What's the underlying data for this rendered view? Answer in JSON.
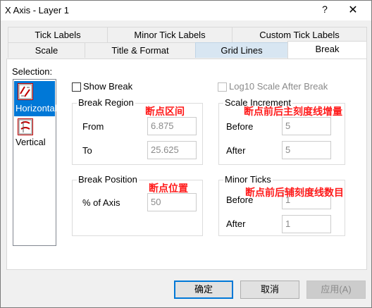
{
  "window": {
    "title": "X Axis - Layer 1",
    "help_label": "?",
    "close_label": "✕"
  },
  "tabs": {
    "row1": [
      {
        "label": "Tick Labels"
      },
      {
        "label": "Minor Tick Labels"
      },
      {
        "label": "Custom Tick Labels"
      }
    ],
    "row2": [
      {
        "label": "Scale"
      },
      {
        "label": "Title & Format"
      },
      {
        "label": "Grid Lines"
      },
      {
        "label": "Break"
      }
    ],
    "selected": "Break"
  },
  "selection": {
    "label": "Selection:",
    "items": [
      {
        "label": "Horizontal",
        "icon": "horizontal-break-icon",
        "selected": true
      },
      {
        "label": "Vertical",
        "icon": "vertical-break-icon",
        "selected": false
      }
    ]
  },
  "show_break": {
    "label": "Show Break",
    "checked": false
  },
  "log10": {
    "label": "Log10 Scale After Break",
    "checked": false,
    "disabled": true
  },
  "break_region": {
    "title": "Break Region",
    "from_label": "From",
    "from_value": "6.875",
    "to_label": "To",
    "to_value": "25.625"
  },
  "scale_increment": {
    "title": "Scale Increment",
    "before_label": "Before",
    "before_value": "5",
    "after_label": "After",
    "after_value": "5"
  },
  "break_position": {
    "title": "Break Position",
    "axis_label": "% of Axis",
    "axis_value": "50"
  },
  "minor_ticks": {
    "title": "Minor Ticks",
    "before_label": "Before",
    "before_value": "1",
    "after_label": "After",
    "after_value": "1"
  },
  "annotations": {
    "break_region": "断点区间",
    "scale_increment": "断点前后主刻度线增量",
    "break_position": "断点位置",
    "minor_ticks": "断点前后辅刻度线数目"
  },
  "buttons": {
    "ok": "确定",
    "cancel": "取消",
    "apply": "应用(A)"
  },
  "colors": {
    "annotation": "#ff1a1a",
    "selection": "#0078d7",
    "hover_tab": "#d8e6f2"
  }
}
